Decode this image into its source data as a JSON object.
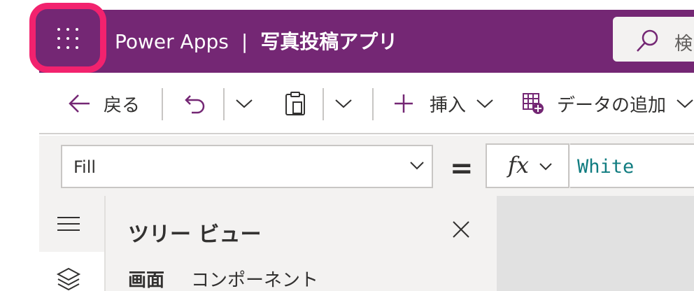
{
  "header": {
    "product": "Power Apps",
    "separator": "|",
    "app_name": "写真投稿アプリ",
    "search_placeholder": "検"
  },
  "toolbar": {
    "back_label": "戻る",
    "insert_label": "挿入",
    "add_data_label": "データの追加"
  },
  "formula_bar": {
    "property": "Fill",
    "equals": "=",
    "fx": "fx",
    "formula": "White"
  },
  "tree_view": {
    "title": "ツリー ビュー",
    "tabs": [
      {
        "label": "画面",
        "active": true
      },
      {
        "label": "コンポーネント",
        "active": false
      }
    ]
  },
  "colors": {
    "brand": "#742774",
    "highlight": "#f2226e",
    "formula_text": "#107c80"
  },
  "icons": [
    "waffle-icon",
    "search-icon",
    "back-arrow-icon",
    "undo-icon",
    "chevron-down-icon",
    "paste-icon",
    "plus-icon",
    "table-add-icon",
    "fx-icon",
    "hamburger-icon",
    "layers-icon",
    "close-icon"
  ]
}
